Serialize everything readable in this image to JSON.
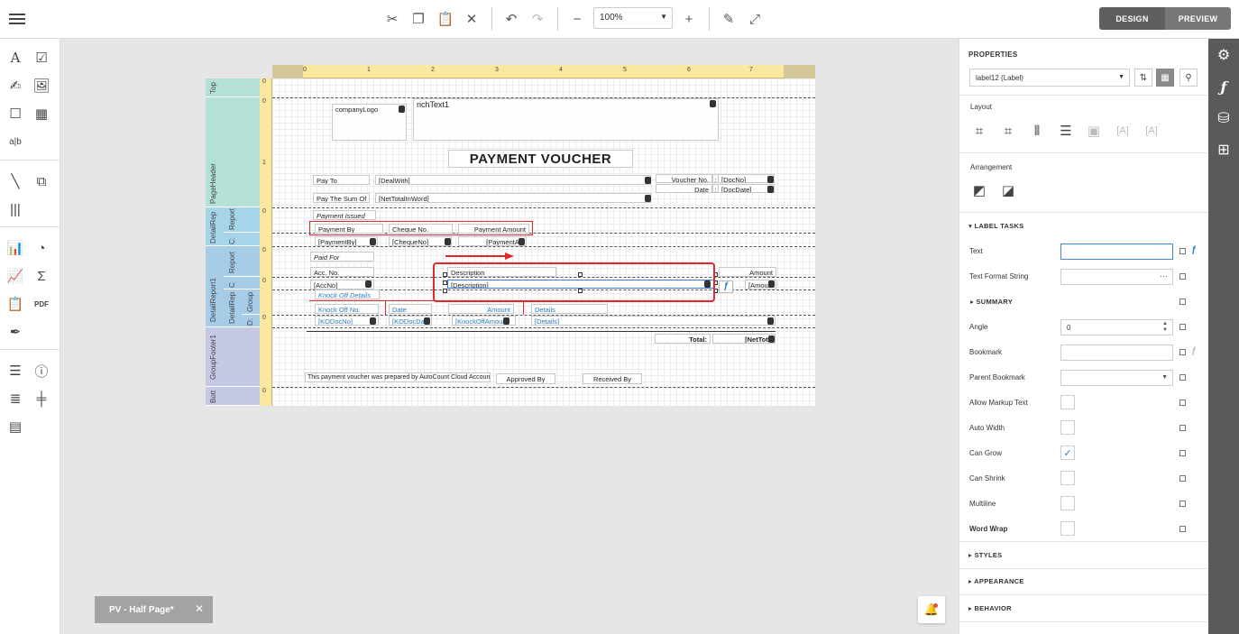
{
  "toolbar": {
    "zoom_value": "100%",
    "mode_design": "DESIGN",
    "mode_preview": "PREVIEW"
  },
  "report": {
    "bands": {
      "top": "Top",
      "page_header": "PageHeader",
      "detail_report_1": "DetailRep",
      "report_1": "Report",
      "c_1": "C:",
      "report_2": "Report",
      "c_2": "C",
      "detail_report_2": "DetailReport1",
      "detail_report_3": "DetailRep",
      "group": "Group",
      "d": "D:",
      "group_footer": "GroupFooter1",
      "bottom": "Bott"
    },
    "ruler_numbers": [
      "0",
      "1",
      "2",
      "3",
      "4",
      "5",
      "6",
      "7"
    ],
    "vruler_numbers": [
      "0",
      "1",
      "0",
      "0",
      "0",
      "0",
      "0",
      "0"
    ],
    "company_logo": "companyLogo",
    "rich_text": "richText1",
    "title": "PAYMENT VOUCHER",
    "pay_to_label": "Pay To",
    "deal_with": "[DealWith]",
    "voucher_no_label": "Voucher No.",
    "colon": ":",
    "doc_no": "[DocNo]",
    "date_label": "Date",
    "doc_date": "[DocDate]",
    "pay_sum_label": "Pay The Sum Of",
    "net_total_word": "[NetTotalInWord]",
    "payment_issued": "Payment Issued",
    "payment_by": "Payment By",
    "cheque_no": "Cheque No.",
    "payment_amount": "Payment Amount",
    "payment_by_f": "[PaymentBy]",
    "cheque_no_f": "[ChequeNo]",
    "payment_amt_f": "[PaymentAn",
    "paid_for": "Paid For",
    "acc_no": "Acc. No.",
    "description": "Description",
    "amount": "Amount",
    "acc_no_f": "[AccNo]",
    "description_f": "[Description]",
    "amount_f": "[Amour",
    "knock_off_details": "Knock Off Details",
    "knock_off_no": "Knock Off No.",
    "ko_date": "Date",
    "ko_amount": "Amount",
    "ko_details": "Details",
    "ko_doc_no_f": "[KODocNo]",
    "ko_doc_date_f": "[KODocDa",
    "ko_amount_f": "[KnockOffAmour",
    "ko_details_f": "[Details]",
    "total_label": "Total:",
    "net_total_f": "[NetTota",
    "footer_note": "This payment voucher was prepared by AutoCount Cloud Accounting.",
    "approved_by": "Approved By",
    "received_by": "Received By"
  },
  "panel": {
    "title": "PROPERTIES",
    "component": "label12 (Label)",
    "layout_label": "Layout",
    "arrangement_label": "Arrangement",
    "label_tasks": "LABEL TASKS",
    "summary": "SUMMARY",
    "styles": "STYLES",
    "appearance": "APPEARANCE",
    "behavior": "BEHAVIOR",
    "props": {
      "text": "Text",
      "text_value": "",
      "text_format": "Text Format String",
      "ellipsis": "···",
      "angle": "Angle",
      "angle_value": "0",
      "bookmark": "Bookmark",
      "parent_bookmark": "Parent Bookmark",
      "allow_markup": "Allow Markup Text",
      "auto_width": "Auto Width",
      "can_grow": "Can Grow",
      "can_shrink": "Can Shrink",
      "multiline": "Multiline",
      "word_wrap": "Word Wrap"
    },
    "can_grow_checked": true
  },
  "report_tab": "PV - Half Page*"
}
